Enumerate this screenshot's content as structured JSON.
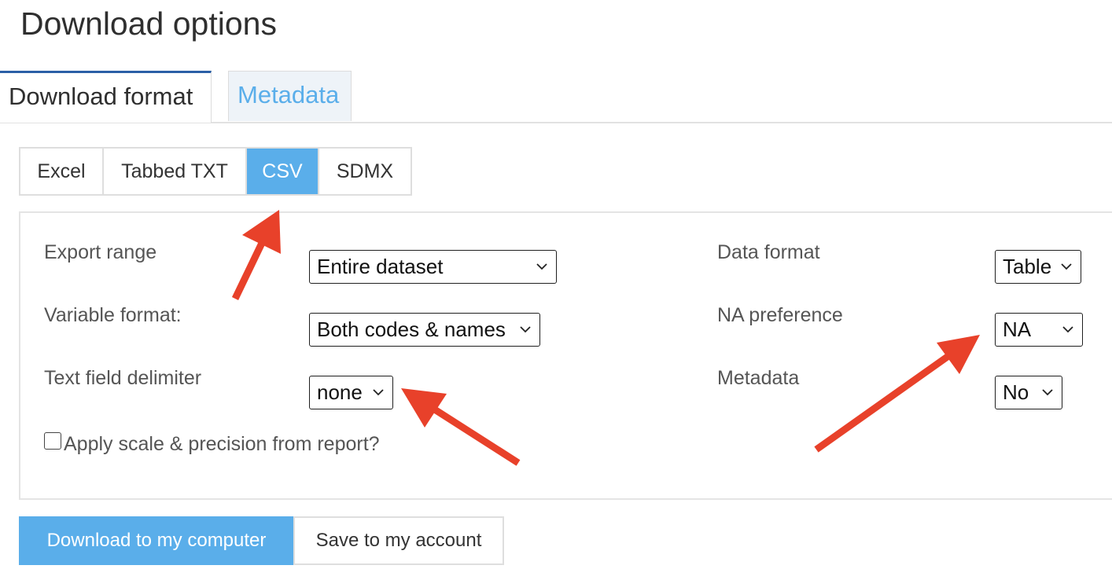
{
  "page": {
    "title": "Download options"
  },
  "tabs": [
    {
      "label": "Download format",
      "active": true
    },
    {
      "label": "Metadata",
      "active": false
    }
  ],
  "formats": [
    {
      "label": "Excel",
      "active": false
    },
    {
      "label": "Tabbed TXT",
      "active": false
    },
    {
      "label": "CSV",
      "active": true
    },
    {
      "label": "SDMX",
      "active": false
    }
  ],
  "options": {
    "export_range": {
      "label": "Export range",
      "value": "Entire dataset"
    },
    "variable_format": {
      "label": "Variable format:",
      "value": "Both codes & names"
    },
    "text_delimiter": {
      "label": "Text field delimiter",
      "value": "none"
    },
    "data_format": {
      "label": "Data format",
      "value": "Table"
    },
    "na_preference": {
      "label": "NA preference",
      "value": "NA"
    },
    "metadata": {
      "label": "Metadata",
      "value": "No"
    },
    "apply_scale": {
      "label": "Apply scale & precision from report?",
      "checked": false
    }
  },
  "buttons": {
    "download": "Download to my computer",
    "save": "Save to my account"
  },
  "colors": {
    "accent": "#5aaeea",
    "tab_border": "#2b5fa6",
    "annotation_arrow": "#e8412a"
  }
}
